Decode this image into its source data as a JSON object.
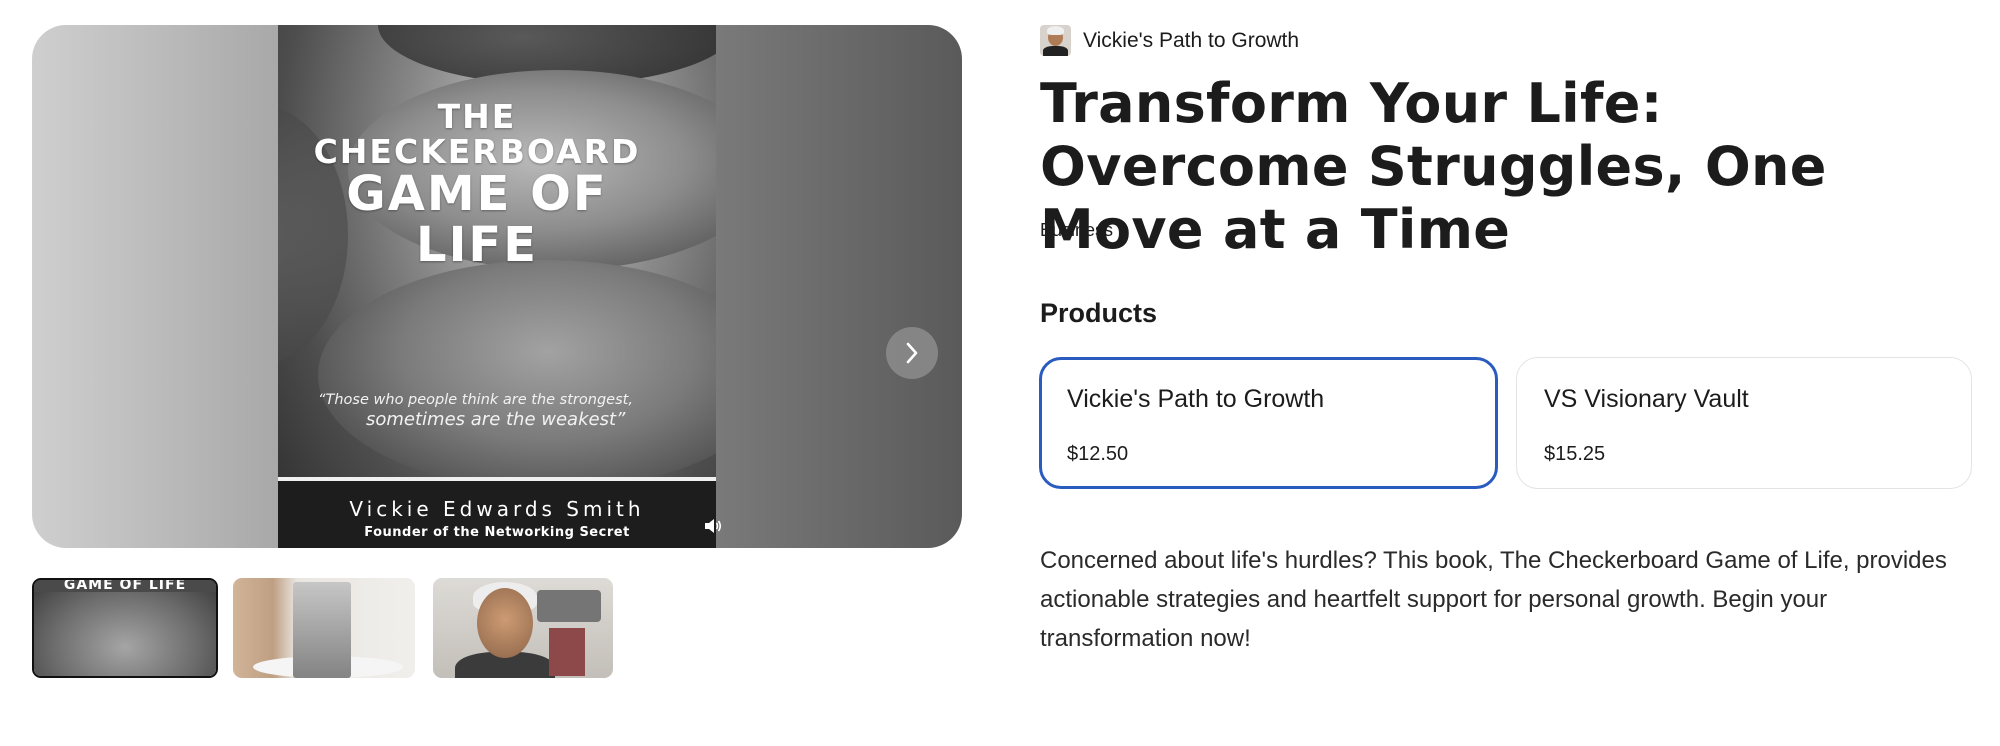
{
  "media": {
    "cover": {
      "title_line1": "THE CHECKERBOARD",
      "title_line2": "GAME OF LIFE",
      "quote_line1": "“Those who people think are the strongest,",
      "quote_line2": "sometimes are the weakest”",
      "author": "Vickie Edwards Smith",
      "role": "Founder of the Networking Secret"
    },
    "icons": {
      "sound": "speaker-icon",
      "next": "chevron-right-icon"
    },
    "thumbnails": [
      {
        "label": "GAME OF LIFE",
        "selected": true
      },
      {
        "selected": false
      },
      {
        "selected": false
      }
    ]
  },
  "shop": {
    "name": "Vickie's Path to Growth"
  },
  "listing": {
    "title": "Transform Your Life: Overcome Struggles, One Move at a Time",
    "category": "Business",
    "products_heading": "Products",
    "products": [
      {
        "name": "Vickie's Path to Growth",
        "price": "$12.50",
        "selected": true
      },
      {
        "name": "VS Visionary Vault",
        "price": "$15.25",
        "selected": false
      }
    ],
    "description": "Concerned about life's hurdles? This book, The Checkerboard Game of Life, provides actionable strategies and heartfelt support for personal growth. Begin your transformation now!"
  },
  "colors": {
    "selected_border": "#2a5bbf",
    "text": "#1c1c1c"
  }
}
